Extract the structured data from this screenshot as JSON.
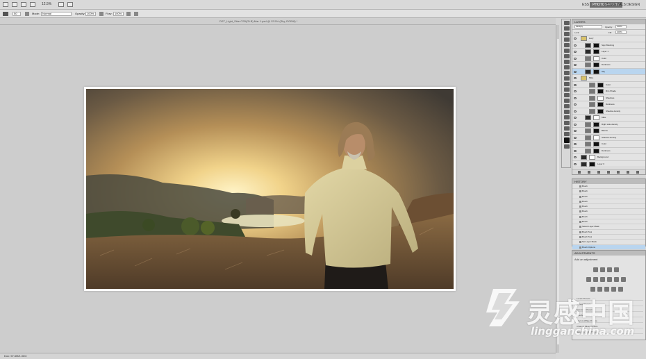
{
  "app": {
    "zoom": "12.5%",
    "workspaces": [
      "ESS",
      "PHOTOGRAPHY",
      "ESSENTIALS",
      "DESIGN"
    ],
    "workspace_active": 1
  },
  "options": {
    "size": "50",
    "mode_label": "Mode:",
    "mode_value": "Normal",
    "opacity_label": "Opacity:",
    "opacity_value": "100%",
    "flow_label": "Flow:",
    "flow_value": "100%"
  },
  "document": {
    "title": "DST_Light_Side CS5(GLB) Mar 1.psd @ 12.5% (Sky, RGB/8) *"
  },
  "status": {
    "text": "Doc: 57.6M/1.06G"
  },
  "layers_panel": {
    "title": "LAYERS",
    "blend": "Multiply",
    "opacity_label": "Opacity:",
    "opacity": "100%",
    "lock_label": "Lock:",
    "fill_label": "Fill:",
    "fill": "100%",
    "layers": [
      {
        "name": "Lucy",
        "type": "group",
        "indent": 0,
        "selected": false
      },
      {
        "name": "Sign Blocking",
        "type": "layer",
        "indent": 1,
        "selected": false
      },
      {
        "name": "Layer 1",
        "type": "layer",
        "indent": 1,
        "selected": false
      },
      {
        "name": "Color",
        "type": "adjust",
        "indent": 1,
        "selected": false
      },
      {
        "name": "Darkness",
        "type": "adjust",
        "indent": 1,
        "selected": false
      },
      {
        "name": "Sky",
        "type": "layer",
        "indent": 1,
        "selected": true
      },
      {
        "name": "Mike",
        "type": "group",
        "indent": 0,
        "selected": false
      },
      {
        "name": "Color",
        "type": "adjust",
        "indent": 2,
        "selected": false
      },
      {
        "name": "Rim Shade",
        "type": "adjust",
        "indent": 2,
        "selected": false
      },
      {
        "name": "Shadows",
        "type": "adjust",
        "indent": 2,
        "selected": false
      },
      {
        "name": "Darkness",
        "type": "adjust",
        "indent": 2,
        "selected": false
      },
      {
        "name": "Shadow density",
        "type": "adjust",
        "indent": 2,
        "selected": false
      },
      {
        "name": "Mike",
        "type": "layer",
        "indent": 1,
        "selected": false
      },
      {
        "name": "Right side density",
        "type": "adjust",
        "indent": 1,
        "selected": false
      },
      {
        "name": "Blacks",
        "type": "adjust",
        "indent": 1,
        "selected": false
      },
      {
        "name": "Shadow density",
        "type": "adjust",
        "indent": 1,
        "selected": false
      },
      {
        "name": "Color",
        "type": "adjust",
        "indent": 1,
        "selected": false
      },
      {
        "name": "Darkness",
        "type": "adjust",
        "indent": 1,
        "selected": false
      },
      {
        "name": "Background",
        "type": "layer",
        "indent": 0,
        "selected": false
      },
      {
        "name": "Layer 0",
        "type": "layer",
        "indent": 0,
        "selected": false
      }
    ]
  },
  "history_panel": {
    "title": "HISTORY",
    "items": [
      "Brush",
      "Brush",
      "Brush",
      "Brush",
      "Brush",
      "Brush",
      "Brush",
      "Brush",
      "Select Layer Mask",
      "Brush Tool",
      "Brush Tool",
      "Set Layer Mask",
      "Brush Options"
    ]
  },
  "adjustments_panel": {
    "title": "ADJUSTMENTS",
    "subtitle": "Add an adjustment",
    "presets": [
      "Levels Presets",
      "Curves Presets",
      "Exposure Presets",
      "Hue/Saturation Presets",
      "Black & White Presets",
      "Channel Mixer Presets",
      "Selective Color Presets"
    ]
  },
  "watermark": {
    "chinese": "灵感中国",
    "english": "lingganchina.com"
  }
}
